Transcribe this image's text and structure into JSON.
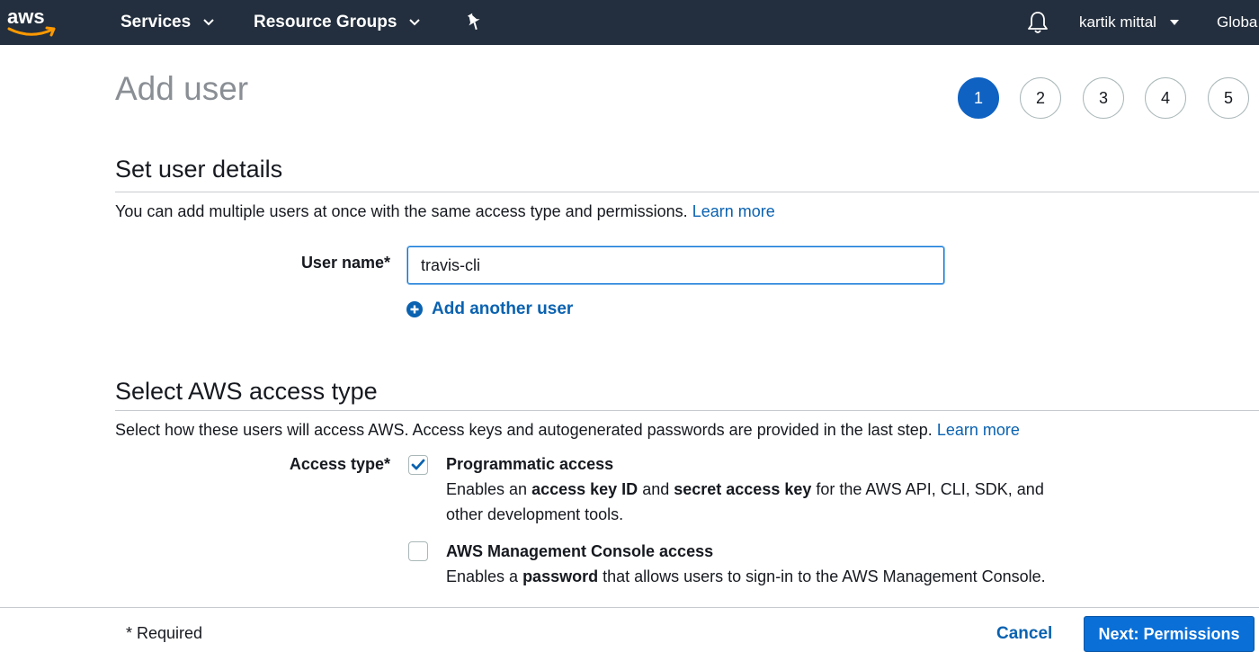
{
  "nav": {
    "logo_text": "aws",
    "services_label": "Services",
    "resource_groups_label": "Resource Groups",
    "user_label": "kartik mittal",
    "region_label": "Globa"
  },
  "page": {
    "title": "Add user",
    "steps": [
      "1",
      "2",
      "3",
      "4",
      "5"
    ],
    "active_step": 1
  },
  "user_details": {
    "section_title": "Set user details",
    "description": "You can add multiple users at once with the same access type and permissions.",
    "learn_more": "Learn more",
    "user_name_label": "User name*",
    "user_name_value": "travis-cli",
    "add_another_user": "Add another user"
  },
  "access_type": {
    "section_title": "Select AWS access type",
    "description": "Select how these users will access AWS. Access keys and autogenerated passwords are provided in the last step.",
    "learn_more": "Learn more",
    "label": "Access type*",
    "options": [
      {
        "title": "Programmatic access",
        "checked": true,
        "desc_parts": [
          "Enables an ",
          "access key ID",
          " and ",
          "secret access key",
          " for the AWS API, CLI, SDK, and other development tools."
        ]
      },
      {
        "title": "AWS Management Console access",
        "checked": false,
        "desc_parts": [
          "Enables a ",
          "password",
          " that allows users to sign-in to the AWS Management Console."
        ]
      }
    ]
  },
  "footer": {
    "required_note": "* Required",
    "cancel_label": "Cancel",
    "next_label": "Next: Permissions"
  },
  "colors": {
    "nav_bg": "#232f3e",
    "accent": "#0a6fd6",
    "link": "#0a62b0",
    "aws_orange": "#ff9900"
  }
}
